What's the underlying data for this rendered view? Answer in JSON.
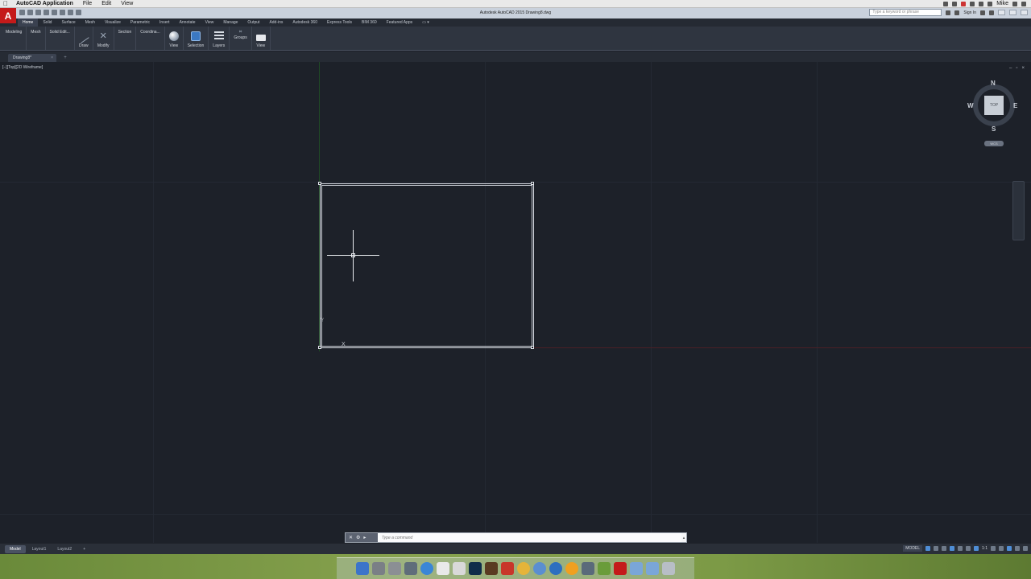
{
  "menubar": {
    "app_name": "AutoCAD Application",
    "items": [
      "File",
      "Edit",
      "View"
    ],
    "user": "Mike"
  },
  "titlebar": {
    "window_title": "Autodesk AutoCAD 2015   Drawing8.dwg",
    "search_placeholder": "Type a keyword or phrase",
    "sign_in": "Sign In"
  },
  "ribbon_tabs": [
    "Home",
    "Solid",
    "Surface",
    "Mesh",
    "Visualize",
    "Parametric",
    "Insert",
    "Annotate",
    "View",
    "Manage",
    "Output",
    "Add-ins",
    "Autodesk 360",
    "Express Tools",
    "BIM 360",
    "Featured Apps"
  ],
  "ribbon_panels": {
    "modeling": "Modeling",
    "mesh": "Mesh",
    "solid_edit": "Solid Edit...",
    "draw": "Draw",
    "modify": "Modify",
    "section": "Section",
    "coordinates": "Coordina...",
    "view": "View",
    "selection": "Selection",
    "layers": "Layers",
    "groups": "Groups",
    "view2": "View"
  },
  "file_tab": {
    "name": "Drawing8*"
  },
  "viewport": {
    "label": "[−][Top][2D Wireframe]",
    "controls": [
      "–",
      "▫",
      "×"
    ]
  },
  "viewcube": {
    "top": "TOP",
    "north": "N",
    "south": "S",
    "east": "E",
    "west": "W",
    "wcs": "WCS"
  },
  "ucs": {
    "x": "X",
    "y": "Y"
  },
  "command_line": {
    "placeholder": "Type a command"
  },
  "layout_tabs": [
    "Model",
    "Layout1",
    "Layout2"
  ],
  "status": {
    "model": "MODEL",
    "scale": "1:1"
  }
}
